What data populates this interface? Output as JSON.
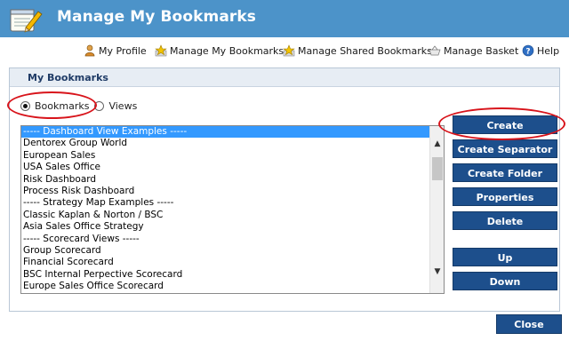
{
  "window": {
    "title": "Manage My Bookmarks"
  },
  "nav": [
    {
      "label": "My Profile",
      "icon": "user-icon"
    },
    {
      "label": "Manage My Bookmarks",
      "icon": "star-bookmark-icon"
    },
    {
      "label": "Manage Shared Bookmarks",
      "icon": "shared-star-icon"
    },
    {
      "label": "Manage Basket",
      "icon": "basket-icon"
    },
    {
      "label": "Help",
      "icon": "help-icon"
    }
  ],
  "panel": {
    "title": "My Bookmarks"
  },
  "view_mode": {
    "options": [
      "Bookmarks",
      "Views"
    ],
    "selected": "Bookmarks"
  },
  "bookmarks": {
    "selected_index": 0,
    "items": [
      "----- Dashboard View Examples -----",
      "Dentorex Group World",
      "European Sales",
      "USA Sales Office",
      "Risk Dashboard",
      "Process Risk Dashboard",
      "----- Strategy Map Examples -----",
      "Classic Kaplan & Norton / BSC",
      "Asia Sales Office Strategy",
      "----- Scorecard Views -----",
      "Group Scorecard",
      "Financial Scorecard",
      "BSC Internal Perpective Scorecard",
      "Europe Sales Office Scorecard"
    ]
  },
  "actions": {
    "create": "Create",
    "create_separator": "Create Separator",
    "create_folder": "Create Folder",
    "properties": "Properties",
    "delete": "Delete",
    "up": "Up",
    "down": "Down"
  },
  "footer": {
    "close": "Close"
  },
  "colors": {
    "titlebar": "#4c93c9",
    "button": "#1d4f8c",
    "selection": "#3399ff",
    "annotation": "#d8141b"
  }
}
